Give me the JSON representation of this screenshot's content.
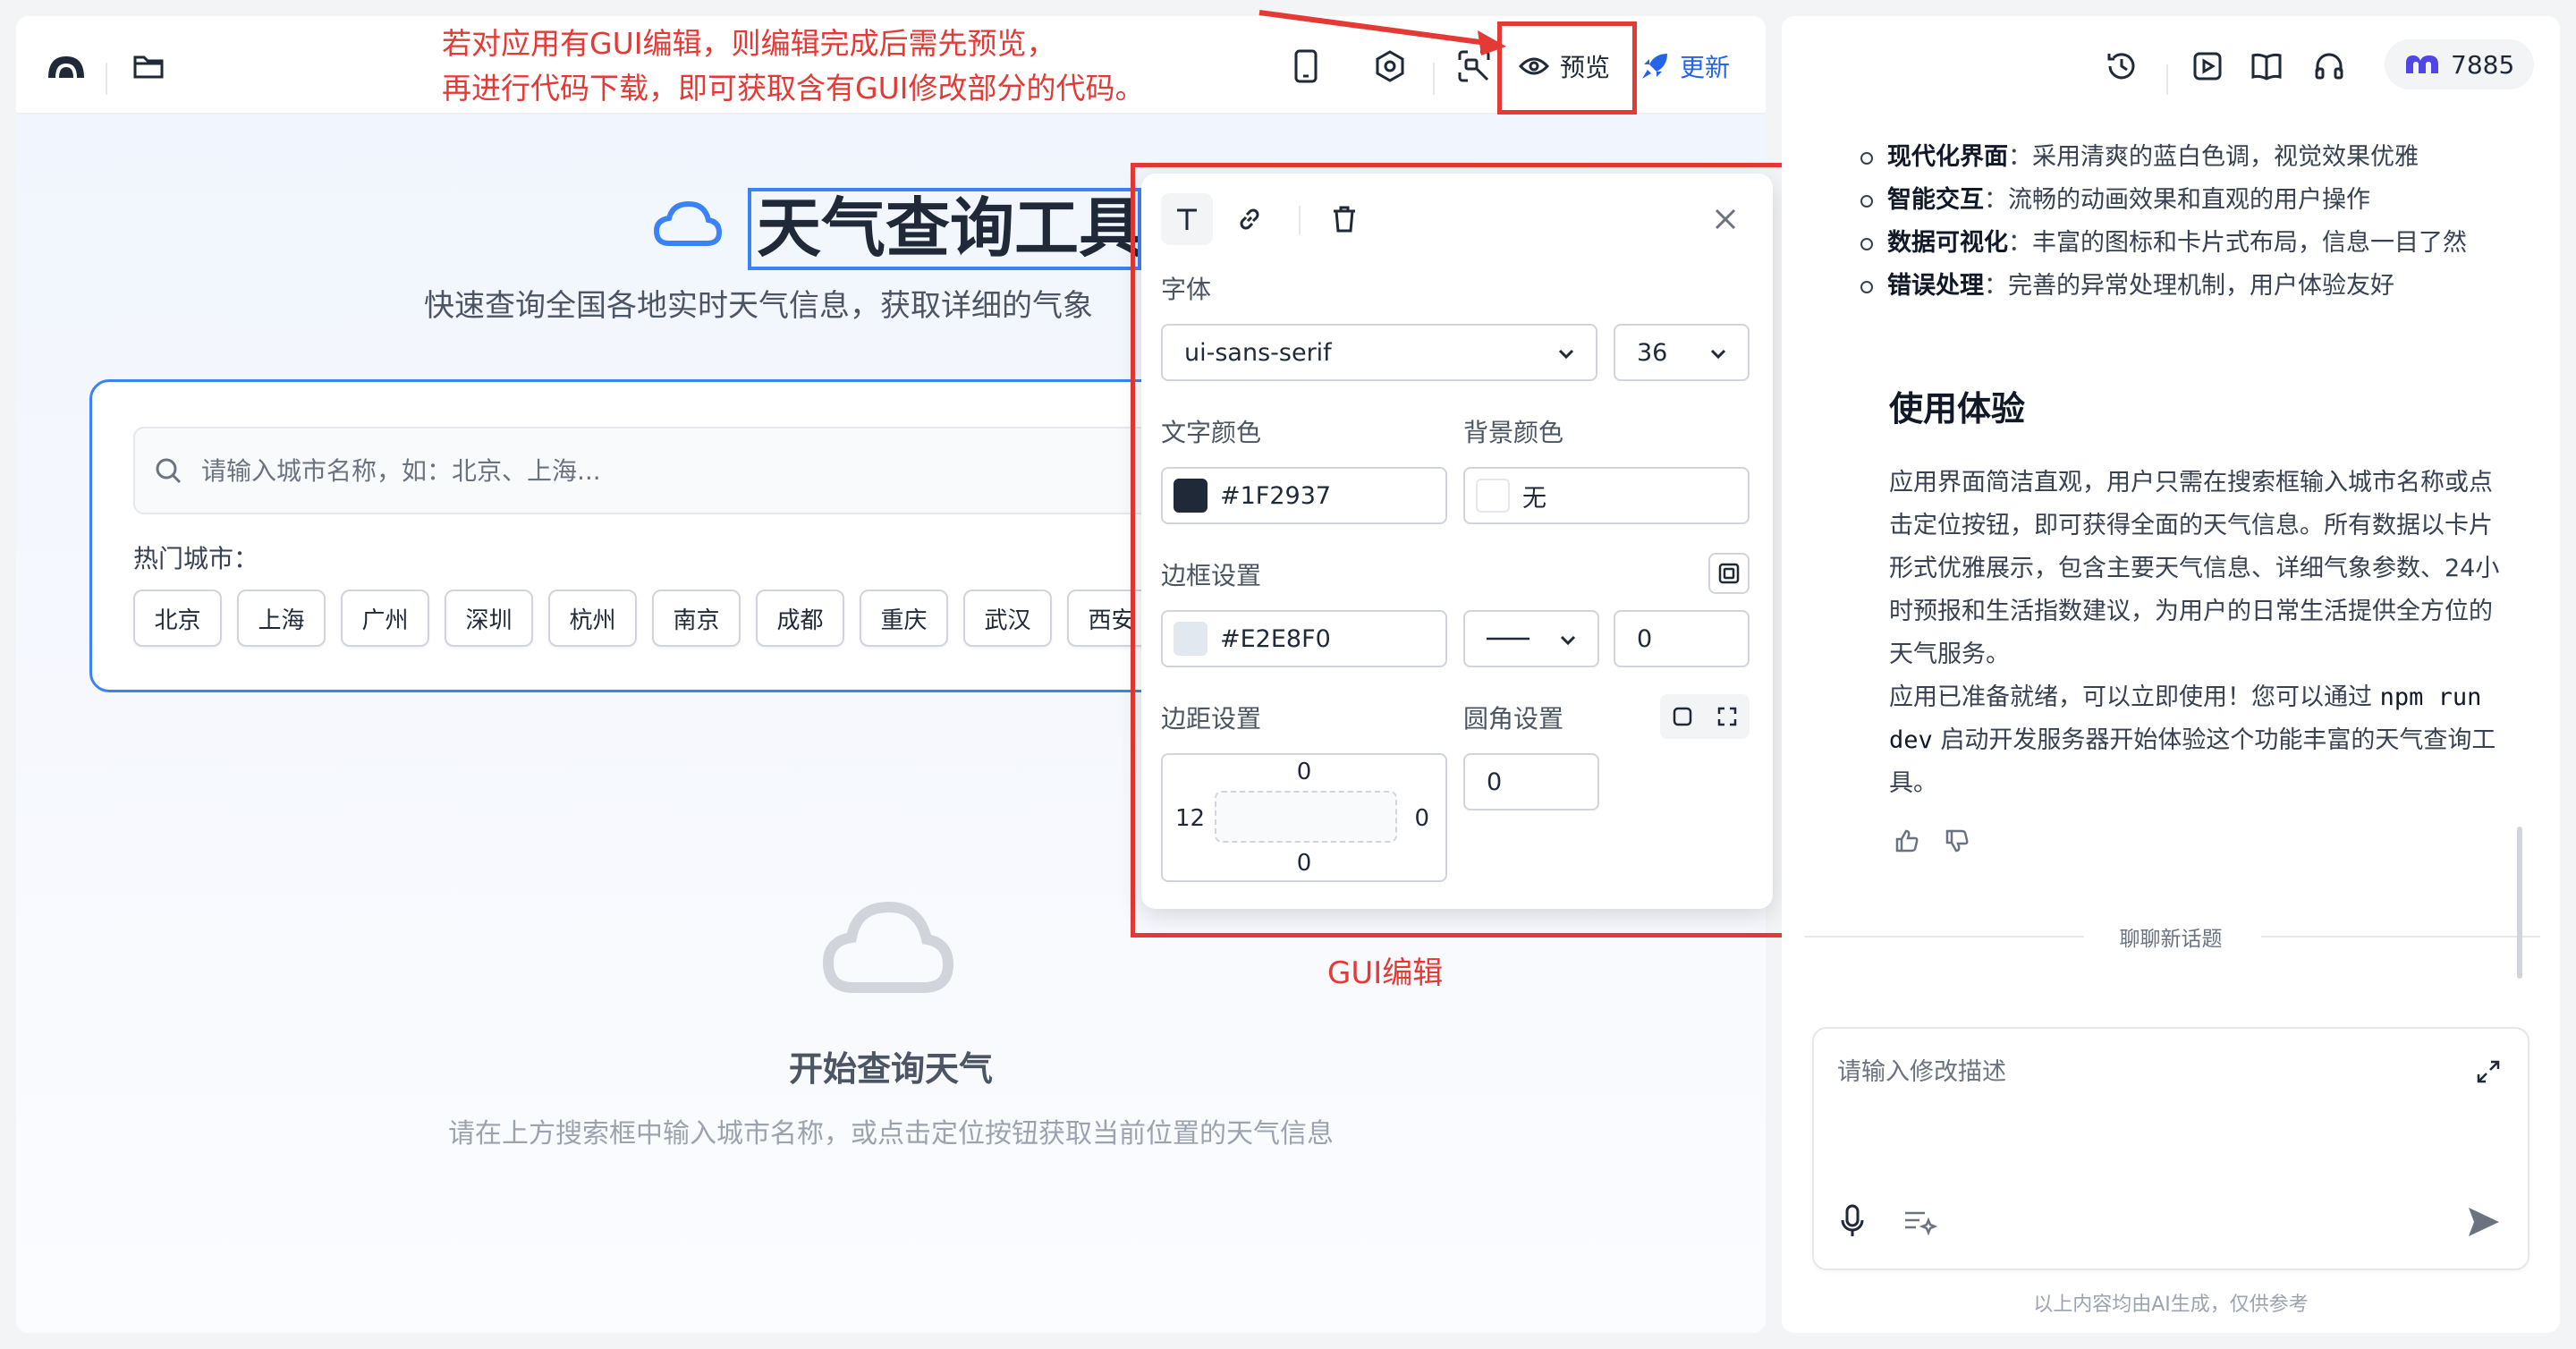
{
  "toolbar": {
    "preview_label": "预览",
    "update_label": "更新"
  },
  "annotation": {
    "top_note_line1": "若对应用有GUI编辑，则编辑完成后需先预览，",
    "top_note_line2": "再进行代码下载，即可获取含有GUI修改部分的代码。",
    "gui_caption": "GUI编辑"
  },
  "app": {
    "title": "天气查询工具",
    "subtitle": "快速查询全国各地实时天气信息，获取详细的气象",
    "search_placeholder": "请输入城市名称，如：北京、上海...",
    "hot_cities_label": "热门城市：",
    "hot_cities": [
      "北京",
      "上海",
      "广州",
      "深圳",
      "杭州",
      "南京",
      "成都",
      "重庆",
      "武汉",
      "西安"
    ],
    "empty_title": "开始查询天气",
    "empty_desc": "请在上方搜索框中输入城市名称，或点击定位按钮获取当前位置的天气信息"
  },
  "gui_editor": {
    "font_label": "字体",
    "font_family": "ui-sans-serif",
    "font_size": "36",
    "text_color_label": "文字颜色",
    "text_color": "#1F2937",
    "bg_color_label": "背景颜色",
    "bg_color": "无",
    "border_label": "边框设置",
    "border_color": "#E2E8F0",
    "border_width": "0",
    "padding_label": "边距设置",
    "padding_top": "0",
    "padding_left": "12",
    "padding_right": "0",
    "padding_bottom": "0",
    "radius_label": "圆角设置",
    "radius_value": "0"
  },
  "chat": {
    "credits": "7885",
    "bullets": [
      {
        "bold": "现代化界面",
        "text": "：采用清爽的蓝白色调，视觉效果优雅"
      },
      {
        "bold": "智能交互",
        "text": "：流畅的动画效果和直观的用户操作"
      },
      {
        "bold": "数据可视化",
        "text": "：丰富的图标和卡片式布局，信息一目了然"
      },
      {
        "bold": "错误处理",
        "text": "：完善的异常处理机制，用户体验友好"
      }
    ],
    "heading": "使用体验",
    "paragraph1": "应用界面简洁直观，用户只需在搜索框输入城市名称或点击定位按钮，即可获得全面的天气信息。所有数据以卡片形式优雅展示，包含主要天气信息、详细气象参数、24小时预报和生活指数建议，为用户的日常生活提供全方位的天气服务。",
    "paragraph2_pre": "应用已准备就绪，可以立即使用！您可以通过 ",
    "paragraph2_code": "npm run dev",
    "paragraph2_post": " 启动开发服务器开始体验这个功能丰富的天气查询工具。",
    "new_topic": "聊聊新话题",
    "input_placeholder": "请输入修改描述",
    "footer": "以上内容均由AI生成，仅供参考"
  },
  "colors": {
    "accent": "#3B82F6",
    "annotation_red": "#E53935",
    "text_primary": "#1F2937"
  }
}
